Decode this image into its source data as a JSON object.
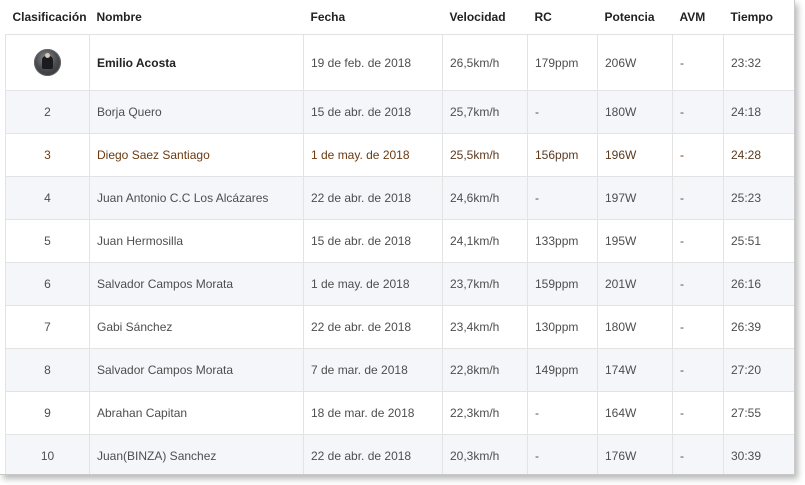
{
  "headers": {
    "rank": "Clasificación",
    "name": "Nombre",
    "date": "Fecha",
    "speed": "Velocidad",
    "rc": "RC",
    "power": "Potencia",
    "avm": "AVM",
    "time": "Tiempo"
  },
  "rows": [
    {
      "rank": "",
      "avatar": "rider-avatar-icon",
      "name": "Emilio Acosta",
      "date": "19 de feb. de 2018",
      "speed": "26,5km/h",
      "rc": "179ppm",
      "power": "206W",
      "avm": "-",
      "time": "23:32"
    },
    {
      "rank": "2",
      "name": "Borja Quero",
      "date": "15 de abr. de 2018",
      "speed": "25,7km/h",
      "rc": "-",
      "power": "180W",
      "avm": "-",
      "time": "24:18"
    },
    {
      "rank": "3",
      "name": "Diego Saez Santiago",
      "date": "1 de may. de 2018",
      "speed": "25,5km/h",
      "rc": "156ppm",
      "power": "196W",
      "avm": "-",
      "time": "24:28"
    },
    {
      "rank": "4",
      "name": "Juan Antonio C.C Los Alcázares",
      "date": "22 de abr. de 2018",
      "speed": "24,6km/h",
      "rc": "-",
      "power": "197W",
      "avm": "-",
      "time": "25:23"
    },
    {
      "rank": "5",
      "name": "Juan Hermosilla",
      "date": "15 de abr. de 2018",
      "speed": "24,1km/h",
      "rc": "133ppm",
      "power": "195W",
      "avm": "-",
      "time": "25:51"
    },
    {
      "rank": "6",
      "name": "Salvador Campos Morata",
      "date": "1 de may. de 2018",
      "speed": "23,7km/h",
      "rc": "159ppm",
      "power": "201W",
      "avm": "-",
      "time": "26:16"
    },
    {
      "rank": "7",
      "name": "Gabi Sánchez",
      "date": "22 de abr. de 2018",
      "speed": "23,4km/h",
      "rc": "130ppm",
      "power": "180W",
      "avm": "-",
      "time": "26:39"
    },
    {
      "rank": "8",
      "name": "Salvador Campos Morata",
      "date": "7 de mar. de 2018",
      "speed": "22,8km/h",
      "rc": "149ppm",
      "power": "174W",
      "avm": "-",
      "time": "27:20"
    },
    {
      "rank": "9",
      "name": "Abrahan Capitan",
      "date": "18 de mar. de 2018",
      "speed": "22,3km/h",
      "rc": "-",
      "power": "164W",
      "avm": "-",
      "time": "27:55"
    },
    {
      "rank": "10",
      "name": "Juan(BINZA) Sanchez",
      "date": "22 de abr. de 2018",
      "speed": "20,3km/h",
      "rc": "-",
      "power": "176W",
      "avm": "-",
      "time": "30:39"
    }
  ],
  "colors": {
    "date_link": "#2f8fbf",
    "highlight_text": "#6b3a10",
    "alt_row": "#f5f6fa"
  }
}
